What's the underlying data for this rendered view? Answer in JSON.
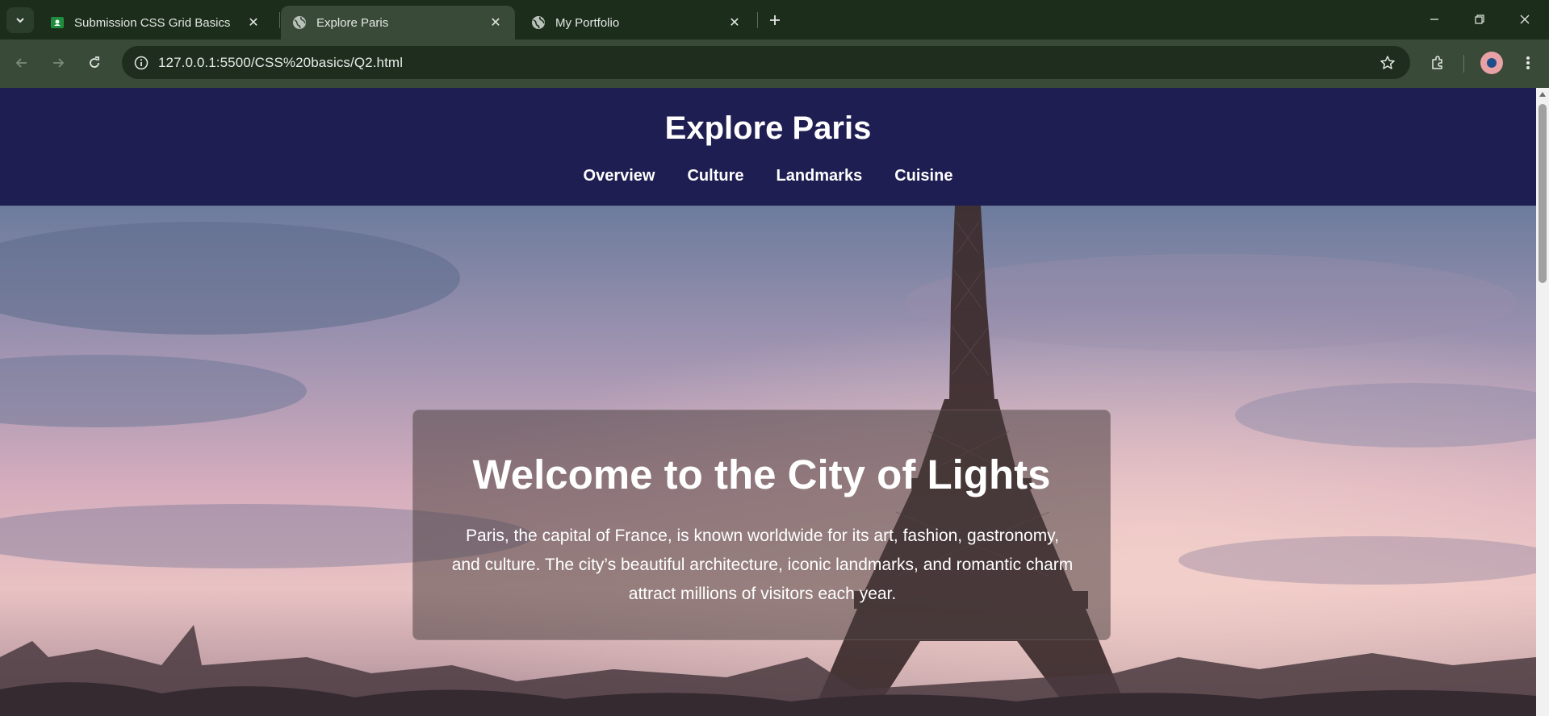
{
  "browser": {
    "tabs": [
      {
        "title": "Submission CSS Grid Basics",
        "icon": "google-classroom-icon",
        "active": false
      },
      {
        "title": "Explore Paris",
        "icon": "globe-icon",
        "active": true
      },
      {
        "title": "My Portfolio",
        "icon": "globe-icon",
        "active": false
      }
    ],
    "url": "127.0.0.1:5500/CSS%20basics/Q2.html"
  },
  "page": {
    "title": "Explore Paris",
    "nav": [
      "Overview",
      "Culture",
      "Landmarks",
      "Cuisine"
    ],
    "hero": {
      "heading": "Welcome to the City of Lights",
      "text": "Paris, the capital of France, is known worldwide for its art, fashion, gastronomy, and culture. The city’s beautiful architecture, iconic landmarks, and romantic charm attract millions of visitors each year.",
      "image": "eiffel-tower-sunset-photo"
    }
  },
  "colors": {
    "header_bg": "#1e1e52",
    "chrome_bg": "#3a4a38",
    "tabbar_bg": "#1c2d1c"
  }
}
